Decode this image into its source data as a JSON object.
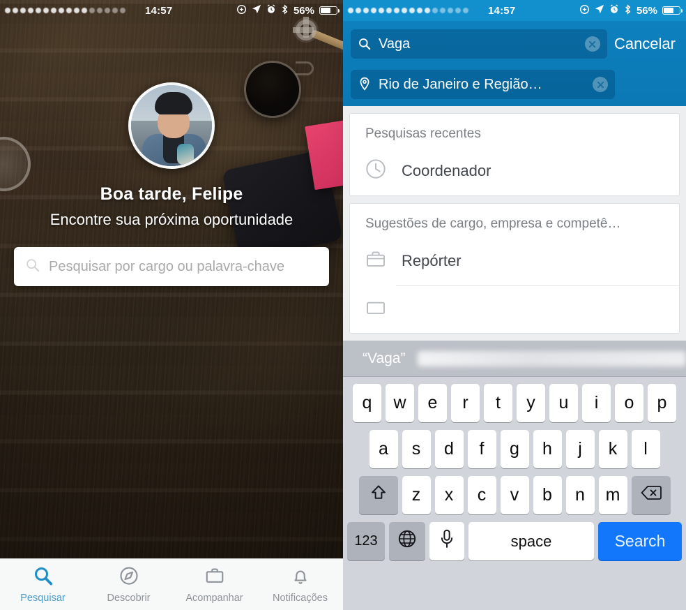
{
  "left": {
    "statusbar": {
      "time": "14:57",
      "battery_pct": "56%",
      "icons": [
        "rotation-lock-icon",
        "location-arrow-icon",
        "alarm-clock-icon",
        "bluetooth-icon",
        "battery-icon"
      ]
    },
    "hero": {
      "avatar_name": "user-avatar",
      "greeting": "Boa tarde, Felipe",
      "subtitle": "Encontre sua próxima oportunidade",
      "search_placeholder": "Pesquisar por cargo ou palavra-chave"
    },
    "tabs": [
      {
        "label": "Pesquisar",
        "icon": "search-icon",
        "active": true
      },
      {
        "label": "Descobrir",
        "icon": "compass-icon",
        "active": false
      },
      {
        "label": "Acompanhar",
        "icon": "briefcase-icon",
        "active": false
      },
      {
        "label": "Notificações",
        "icon": "bell-icon",
        "active": false
      }
    ]
  },
  "right": {
    "statusbar": {
      "time": "14:57",
      "battery_pct": "56%"
    },
    "search": {
      "keyword_value": "Vaga",
      "keyword_icon": "search-icon",
      "location_value": "Rio de Janeiro e Região…",
      "location_icon": "map-pin-icon",
      "clear_icon": "clear-circle-icon",
      "cancel_label": "Cancelar"
    },
    "recent": {
      "title": "Pesquisas recentes",
      "items": [
        {
          "label": "Coordenador",
          "icon": "clock-icon"
        }
      ]
    },
    "suggestions": {
      "title": "Sugestões de cargo, empresa e competê…",
      "items": [
        {
          "label": "Repórter",
          "icon": "briefcase-icon"
        }
      ]
    },
    "keyboard": {
      "suggestion_word": "“Vaga”",
      "row1": [
        "q",
        "w",
        "e",
        "r",
        "t",
        "y",
        "u",
        "i",
        "o",
        "p"
      ],
      "row2": [
        "a",
        "s",
        "d",
        "f",
        "g",
        "h",
        "j",
        "k",
        "l"
      ],
      "row3": [
        "z",
        "x",
        "c",
        "v",
        "b",
        "n",
        "m"
      ],
      "shift_icon": "shift-arrow-icon",
      "delete_icon": "backspace-icon",
      "numeric_label": "123",
      "globe_icon": "globe-icon",
      "mic_icon": "microphone-icon",
      "space_label": "space",
      "search_label": "Search"
    }
  },
  "colors": {
    "linkedin_blue": "#0b78b4",
    "status_blue": "#1290ce",
    "ios_key_blue": "#1277fb",
    "active_tab": "#4b9cc6",
    "keyboard_bg": "#d1d4da"
  }
}
